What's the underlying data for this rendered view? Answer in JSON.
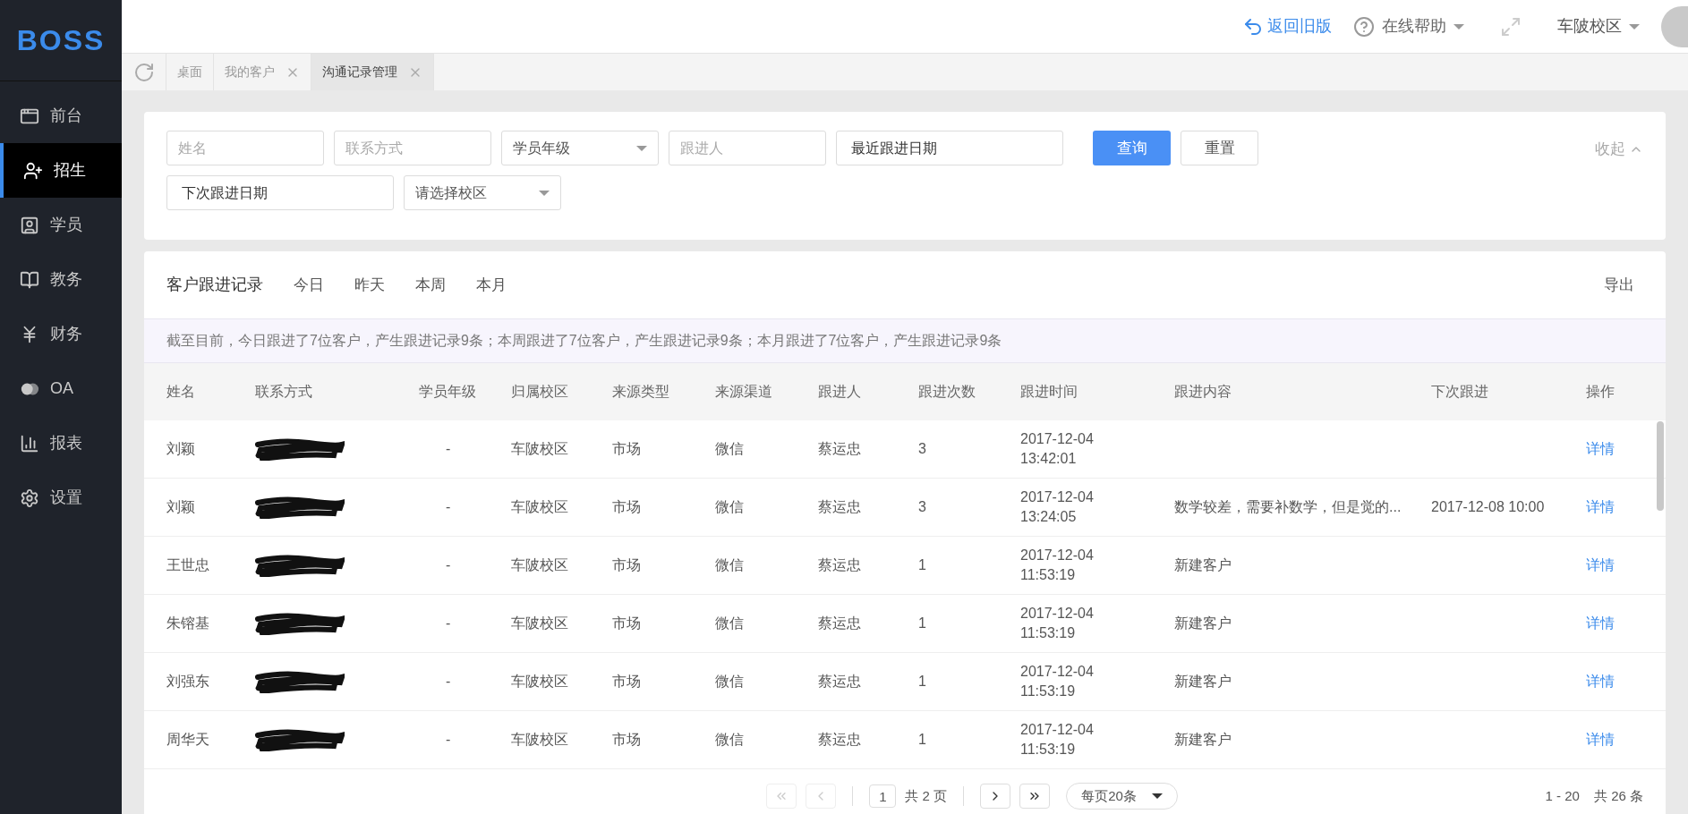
{
  "logo": "BOSS",
  "sidebar": {
    "items": [
      {
        "label": "前台",
        "selected": false
      },
      {
        "label": "招生",
        "selected": true
      },
      {
        "label": "学员",
        "selected": false
      },
      {
        "label": "教务",
        "selected": false
      },
      {
        "label": "财务",
        "selected": false
      },
      {
        "label": "OA",
        "selected": false
      },
      {
        "label": "报表",
        "selected": false
      },
      {
        "label": "设置",
        "selected": false
      }
    ]
  },
  "header": {
    "back_link": "返回旧版",
    "help": "在线帮助",
    "campus": "车陂校区"
  },
  "tabs": [
    {
      "label": "桌面",
      "closable": false,
      "selected": false
    },
    {
      "label": "我的客户",
      "closable": true,
      "selected": false
    },
    {
      "label": "沟通记录管理",
      "closable": true,
      "selected": true
    }
  ],
  "filters": {
    "row_1": [
      {
        "kind": "input",
        "placeholder": "姓名"
      },
      {
        "kind": "input",
        "placeholder": "联系方式"
      },
      {
        "kind": "select",
        "value": "学员年级"
      },
      {
        "kind": "input",
        "placeholder": "跟进人"
      },
      {
        "kind": "date",
        "value": "最近跟进日期"
      }
    ],
    "row_2": [
      {
        "kind": "date",
        "value": "下次跟进日期"
      },
      {
        "kind": "select",
        "value": "请选择校区"
      }
    ],
    "search_button": "查询",
    "reset_button": "重置",
    "collapse": "收起"
  },
  "records": {
    "title": "客户跟进记录",
    "periods": [
      {
        "label": "今日",
        "selected": false
      },
      {
        "label": "昨天",
        "selected": false
      },
      {
        "label": "本周",
        "selected": false
      },
      {
        "label": "本月",
        "selected": false
      }
    ],
    "export": "导出",
    "summary": "截至目前，今日跟进了7位客户，产生跟进记录9条；本周跟进了7位客户，产生跟进记录9条；本月跟进了7位客户，产生跟进记录9条",
    "columns": [
      "姓名",
      "联系方式",
      "学员年级",
      "归属校区",
      "来源类型",
      "来源渠道",
      "跟进人",
      "跟进次数",
      "跟进时间",
      "跟进内容",
      "下次跟进",
      "操作"
    ],
    "rows": [
      {
        "name": "刘颖",
        "grade": "-",
        "campus": "车陂校区",
        "source_type": "市场",
        "channel": "微信",
        "follower": "蔡运忠",
        "count": "3",
        "date": "2017-12-04",
        "time": "13:42:01",
        "content": "",
        "next": "",
        "action": "详情"
      },
      {
        "name": "刘颖",
        "grade": "-",
        "campus": "车陂校区",
        "source_type": "市场",
        "channel": "微信",
        "follower": "蔡运忠",
        "count": "3",
        "date": "2017-12-04",
        "time": "13:24:05",
        "content": "数学较差，需要补数学，但是觉的...",
        "next": "2017-12-08 10:00",
        "action": "详情"
      },
      {
        "name": "王世忠",
        "grade": "-",
        "campus": "车陂校区",
        "source_type": "市场",
        "channel": "微信",
        "follower": "蔡运忠",
        "count": "1",
        "date": "2017-12-04",
        "time": "11:53:19",
        "content": "新建客户",
        "next": "",
        "action": "详情"
      },
      {
        "name": "朱镕基",
        "grade": "-",
        "campus": "车陂校区",
        "source_type": "市场",
        "channel": "微信",
        "follower": "蔡运忠",
        "count": "1",
        "date": "2017-12-04",
        "time": "11:53:19",
        "content": "新建客户",
        "next": "",
        "action": "详情"
      },
      {
        "name": "刘强东",
        "grade": "-",
        "campus": "车陂校区",
        "source_type": "市场",
        "channel": "微信",
        "follower": "蔡运忠",
        "count": "1",
        "date": "2017-12-04",
        "time": "11:53:19",
        "content": "新建客户",
        "next": "",
        "action": "详情"
      },
      {
        "name": "周华天",
        "grade": "-",
        "campus": "车陂校区",
        "source_type": "市场",
        "channel": "微信",
        "follower": "蔡运忠",
        "count": "1",
        "date": "2017-12-04",
        "time": "11:53:19",
        "content": "新建客户",
        "next": "",
        "action": "详情"
      }
    ]
  },
  "pagination": {
    "page": "1",
    "total_pages": "共 2 页",
    "page_size": "每页20条",
    "range": "1 - 20",
    "total": "共 26 条"
  }
}
